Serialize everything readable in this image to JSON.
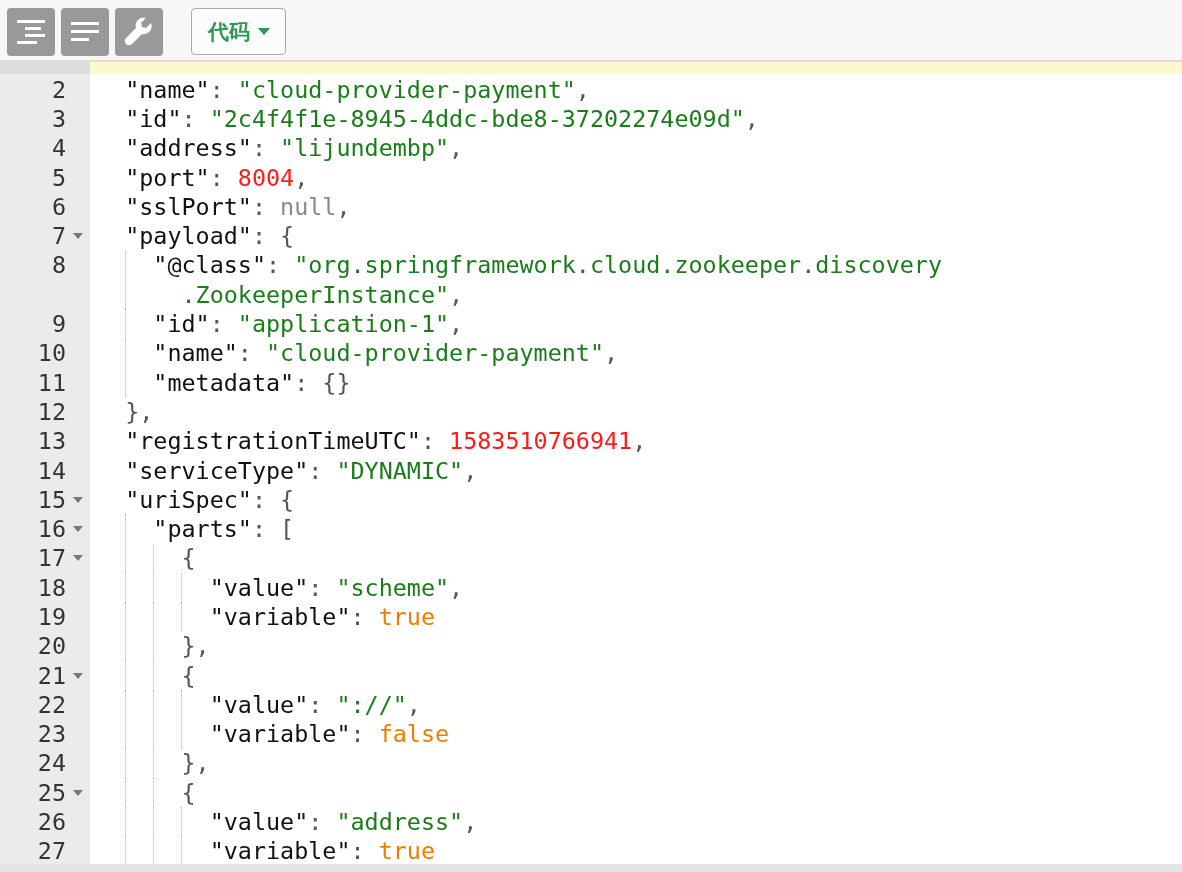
{
  "toolbar": {
    "icon_buttons": [
      {
        "kind": "indent"
      },
      {
        "kind": "lines"
      },
      {
        "kind": "wrench"
      }
    ],
    "dropdown": {
      "label": "代码"
    }
  },
  "editor": {
    "lines": [
      {
        "number": "2",
        "fold": false,
        "tokens": [
          {
            "t": "  \"name\"",
            "kind": "key"
          },
          {
            "t": ": ",
            "kind": "punct"
          },
          {
            "t": "\"cloud-provider-payment\"",
            "kind": "string"
          },
          {
            "t": ",",
            "kind": "punct"
          }
        ]
      },
      {
        "number": "3",
        "fold": false,
        "tokens": [
          {
            "t": "  \"id\"",
            "kind": "key"
          },
          {
            "t": ": ",
            "kind": "punct"
          },
          {
            "t": "\"2c4f4f1e-8945-4ddc-bde8-37202274e09d\"",
            "kind": "string"
          },
          {
            "t": ",",
            "kind": "punct"
          }
        ]
      },
      {
        "number": "4",
        "fold": false,
        "tokens": [
          {
            "t": "  \"address\"",
            "kind": "key"
          },
          {
            "t": ": ",
            "kind": "punct"
          },
          {
            "t": "\"lijundembp\"",
            "kind": "string"
          },
          {
            "t": ",",
            "kind": "punct"
          }
        ]
      },
      {
        "number": "5",
        "fold": false,
        "tokens": [
          {
            "t": "  \"port\"",
            "kind": "key"
          },
          {
            "t": ": ",
            "kind": "punct"
          },
          {
            "t": "8004",
            "kind": "number"
          },
          {
            "t": ",",
            "kind": "punct"
          }
        ]
      },
      {
        "number": "6",
        "fold": false,
        "tokens": [
          {
            "t": "  \"sslPort\"",
            "kind": "key"
          },
          {
            "t": ": ",
            "kind": "punct"
          },
          {
            "t": "null",
            "kind": "null"
          },
          {
            "t": ",",
            "kind": "punct"
          }
        ]
      },
      {
        "number": "7",
        "fold": true,
        "tokens": [
          {
            "t": "  \"payload\"",
            "kind": "key"
          },
          {
            "t": ": {",
            "kind": "punct"
          }
        ]
      },
      {
        "number": "8",
        "fold": false,
        "tokens": [
          {
            "t": "    \"@class\"",
            "kind": "key"
          },
          {
            "t": ": ",
            "kind": "punct"
          },
          {
            "t": "\"org.springframework.cloud.zookeeper.discovery",
            "kind": "string"
          }
        ],
        "continuation": [
          {
            "t": ".ZookeeperInstance\"",
            "kind": "string"
          },
          {
            "t": ",",
            "kind": "punct"
          }
        ]
      },
      {
        "number": "9",
        "fold": false,
        "tokens": [
          {
            "t": "    \"id\"",
            "kind": "key"
          },
          {
            "t": ": ",
            "kind": "punct"
          },
          {
            "t": "\"application-1\"",
            "kind": "string"
          },
          {
            "t": ",",
            "kind": "punct"
          }
        ]
      },
      {
        "number": "10",
        "fold": false,
        "tokens": [
          {
            "t": "    \"name\"",
            "kind": "key"
          },
          {
            "t": ": ",
            "kind": "punct"
          },
          {
            "t": "\"cloud-provider-payment\"",
            "kind": "string"
          },
          {
            "t": ",",
            "kind": "punct"
          }
        ]
      },
      {
        "number": "11",
        "fold": false,
        "tokens": [
          {
            "t": "    \"metadata\"",
            "kind": "key"
          },
          {
            "t": ": {}",
            "kind": "punct"
          }
        ]
      },
      {
        "number": "12",
        "fold": false,
        "tokens": [
          {
            "t": "  },",
            "kind": "punct"
          }
        ]
      },
      {
        "number": "13",
        "fold": false,
        "tokens": [
          {
            "t": "  \"registrationTimeUTC\"",
            "kind": "key"
          },
          {
            "t": ": ",
            "kind": "punct"
          },
          {
            "t": "1583510766941",
            "kind": "number"
          },
          {
            "t": ",",
            "kind": "punct"
          }
        ]
      },
      {
        "number": "14",
        "fold": false,
        "tokens": [
          {
            "t": "  \"serviceType\"",
            "kind": "key"
          },
          {
            "t": ": ",
            "kind": "punct"
          },
          {
            "t": "\"DYNAMIC\"",
            "kind": "string"
          },
          {
            "t": ",",
            "kind": "punct"
          }
        ]
      },
      {
        "number": "15",
        "fold": true,
        "tokens": [
          {
            "t": "  \"uriSpec\"",
            "kind": "key"
          },
          {
            "t": ": {",
            "kind": "punct"
          }
        ]
      },
      {
        "number": "16",
        "fold": true,
        "tokens": [
          {
            "t": "    \"parts\"",
            "kind": "key"
          },
          {
            "t": ": [",
            "kind": "punct"
          }
        ]
      },
      {
        "number": "17",
        "fold": true,
        "tokens": [
          {
            "t": "      {",
            "kind": "punct"
          }
        ]
      },
      {
        "number": "18",
        "fold": false,
        "tokens": [
          {
            "t": "        \"value\"",
            "kind": "key"
          },
          {
            "t": ": ",
            "kind": "punct"
          },
          {
            "t": "\"scheme\"",
            "kind": "string"
          },
          {
            "t": ",",
            "kind": "punct"
          }
        ]
      },
      {
        "number": "19",
        "fold": false,
        "tokens": [
          {
            "t": "        \"variable\"",
            "kind": "key"
          },
          {
            "t": ": ",
            "kind": "punct"
          },
          {
            "t": "true",
            "kind": "bool"
          }
        ]
      },
      {
        "number": "20",
        "fold": false,
        "tokens": [
          {
            "t": "      },",
            "kind": "punct"
          }
        ]
      },
      {
        "number": "21",
        "fold": true,
        "tokens": [
          {
            "t": "      {",
            "kind": "punct"
          }
        ]
      },
      {
        "number": "22",
        "fold": false,
        "tokens": [
          {
            "t": "        \"value\"",
            "kind": "key"
          },
          {
            "t": ": ",
            "kind": "punct"
          },
          {
            "t": "\"://\"",
            "kind": "string"
          },
          {
            "t": ",",
            "kind": "punct"
          }
        ]
      },
      {
        "number": "23",
        "fold": false,
        "tokens": [
          {
            "t": "        \"variable\"",
            "kind": "key"
          },
          {
            "t": ": ",
            "kind": "punct"
          },
          {
            "t": "false",
            "kind": "bool"
          }
        ]
      },
      {
        "number": "24",
        "fold": false,
        "tokens": [
          {
            "t": "      },",
            "kind": "punct"
          }
        ]
      },
      {
        "number": "25",
        "fold": true,
        "tokens": [
          {
            "t": "      {",
            "kind": "punct"
          }
        ]
      },
      {
        "number": "26",
        "fold": false,
        "tokens": [
          {
            "t": "        \"value\"",
            "kind": "key"
          },
          {
            "t": ": ",
            "kind": "punct"
          },
          {
            "t": "\"address\"",
            "kind": "string"
          },
          {
            "t": ",",
            "kind": "punct"
          }
        ]
      },
      {
        "number": "27",
        "fold": false,
        "tokens": [
          {
            "t": "        \"variable\"",
            "kind": "key"
          },
          {
            "t": ": ",
            "kind": "punct"
          },
          {
            "t": "true",
            "kind": "bool"
          }
        ]
      }
    ]
  }
}
